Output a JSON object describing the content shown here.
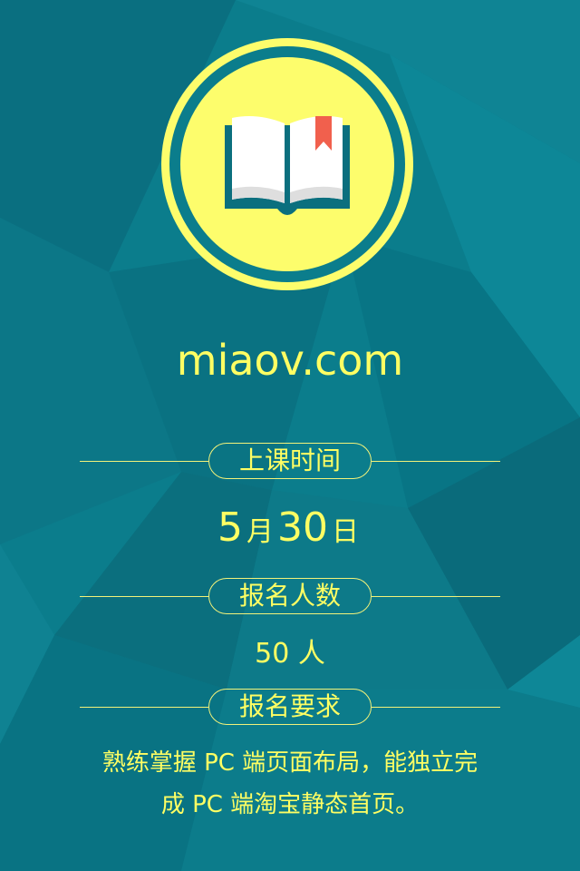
{
  "site": {
    "name": "miaov.com"
  },
  "sections": {
    "schedule": {
      "label": "上课时间",
      "month": "5",
      "month_unit": "月",
      "day": "30",
      "day_unit": "日"
    },
    "enrollment": {
      "label": "报名人数",
      "count_text": "50 人"
    },
    "requirements": {
      "label": "报名要求",
      "line1": "熟练掌握 PC 端页面布局，能独立完",
      "line2": "成 PC 端淘宝静态首页。"
    }
  },
  "icons": {
    "logo": "open-book-icon",
    "bookmark": "bookmark-ribbon-icon"
  },
  "colors": {
    "accent": "#fefe63",
    "background": "#0b7d8c",
    "ring": "#fdfd6c",
    "bookmark": "#f1604d"
  }
}
